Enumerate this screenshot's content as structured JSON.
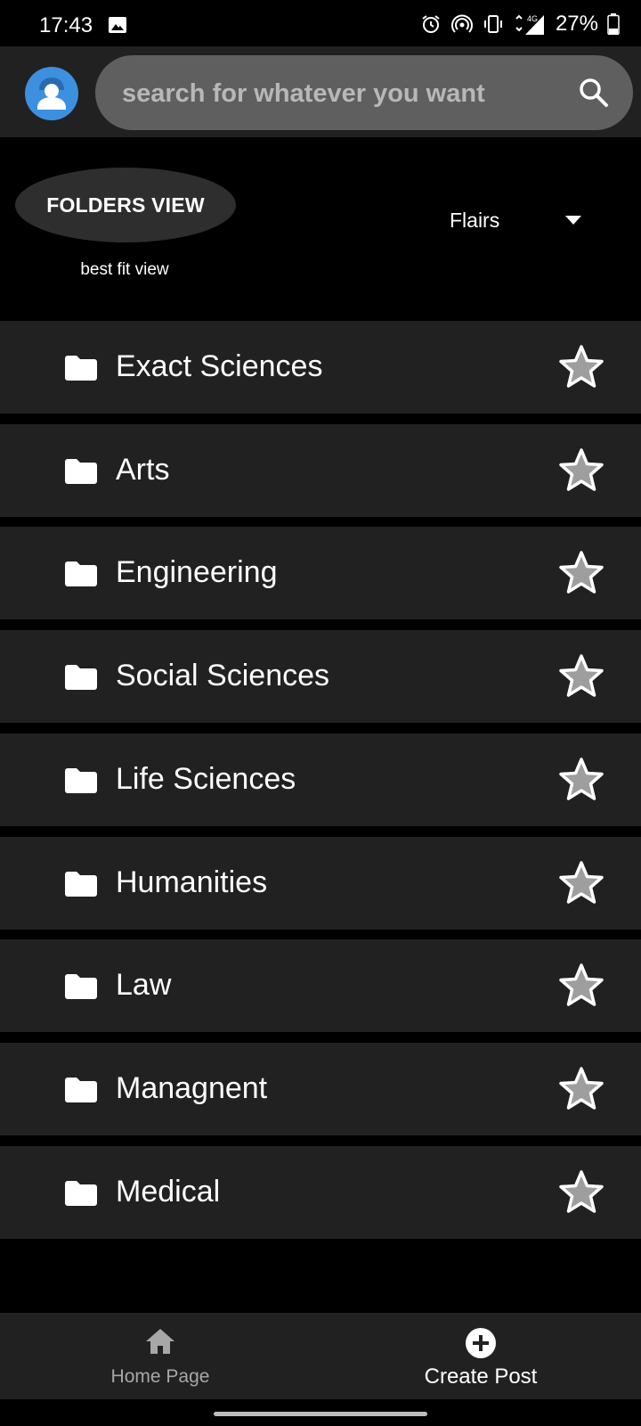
{
  "status_bar": {
    "time": "17:43",
    "battery": "27%",
    "network": "4G"
  },
  "search": {
    "placeholder": "search for whatever you want"
  },
  "view_toggle": {
    "label": "FOLDERS VIEW",
    "subtitle": "best fit view"
  },
  "filter": {
    "label": "Flairs"
  },
  "folders": [
    {
      "label": "Exact Sciences"
    },
    {
      "label": "Arts"
    },
    {
      "label": "Engineering"
    },
    {
      "label": "Social Sciences"
    },
    {
      "label": "Life Sciences"
    },
    {
      "label": "Humanities"
    },
    {
      "label": "Law"
    },
    {
      "label": "Managnent"
    },
    {
      "label": "Medical"
    }
  ],
  "bottom_nav": {
    "home_label": "Home Page",
    "create_label": "Create Post"
  },
  "colors": {
    "background": "#000000",
    "surface": "#212121",
    "search_bg": "#5f5f5f",
    "avatar_bg": "#3d8fe0",
    "star_fill": "#9e9e9e"
  }
}
